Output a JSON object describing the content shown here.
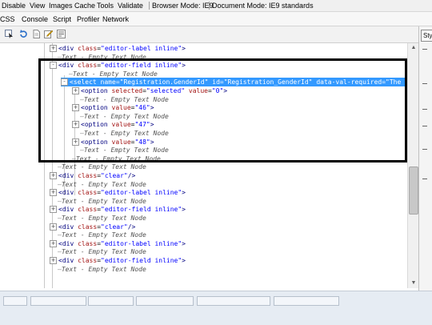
{
  "menu": [
    {
      "label": "Disable"
    },
    {
      "label": "View"
    },
    {
      "label": "Images"
    },
    {
      "label": "Cache"
    },
    {
      "label": "Tools"
    },
    {
      "label": "Validate"
    },
    {
      "label": "Browser Mode: IE9"
    },
    {
      "label": "Document Mode: IE9 standards"
    }
  ],
  "tabs": [
    {
      "label": "CSS"
    },
    {
      "label": "Console"
    },
    {
      "label": "Script"
    },
    {
      "label": "Profiler"
    },
    {
      "label": "Network"
    }
  ],
  "right_panel": {
    "style_tab": "Sty"
  },
  "tree": [
    {
      "kind": "elem",
      "expander": "+",
      "html_tag": "<div",
      "attrs": [
        {
          "n": "class",
          "v": "\"editor-label inline\""
        }
      ],
      "close": ">"
    },
    {
      "kind": "text",
      "text": "Text - Empty Text Node"
    },
    {
      "kind": "elem",
      "expander": "-",
      "html_tag": "<div",
      "attrs": [
        {
          "n": "class",
          "v": "\"editor-field inline\""
        }
      ],
      "close": ">"
    },
    {
      "kind": "text",
      "text": "Text - Empty Text Node"
    },
    {
      "kind": "sel",
      "expander": "-",
      "html_tag": "<select",
      "attrs": [
        {
          "n": "name",
          "v": "\"Registration.GenderId\""
        },
        {
          "n": "id",
          "v": "\"Registration_GenderId\""
        },
        {
          "n": "data-val-required",
          "v": "\"The Ge"
        }
      ],
      "close": ""
    },
    {
      "kind": "elem",
      "expander": "+",
      "html_tag": "<option",
      "attrs": [
        {
          "n": "selected",
          "v": "\"selected\""
        },
        {
          "n": "value",
          "v": "\"0\""
        }
      ],
      "close": ">"
    },
    {
      "kind": "text",
      "text": "Text - Empty Text Node"
    },
    {
      "kind": "elem",
      "expander": "+",
      "html_tag": "<option",
      "attrs": [
        {
          "n": "value",
          "v": "\"46\""
        }
      ],
      "close": ">"
    },
    {
      "kind": "text",
      "text": "Text - Empty Text Node"
    },
    {
      "kind": "elem",
      "expander": "+",
      "html_tag": "<option",
      "attrs": [
        {
          "n": "value",
          "v": "\"47\""
        }
      ],
      "close": ">"
    },
    {
      "kind": "text",
      "text": "Text - Empty Text Node"
    },
    {
      "kind": "elem",
      "expander": "+",
      "html_tag": "<option",
      "attrs": [
        {
          "n": "value",
          "v": "\"48\""
        }
      ],
      "close": ">"
    },
    {
      "kind": "text",
      "text": "Text - Empty Text Node"
    },
    {
      "kind": "text",
      "text": "Text - Empty Text Node"
    },
    {
      "kind": "text",
      "text": "Text - Empty Text Node"
    },
    {
      "kind": "elem",
      "expander": "+",
      "html_tag": "<div",
      "attrs": [
        {
          "n": "class",
          "v": "\"clear\""
        }
      ],
      "close": "/>"
    },
    {
      "kind": "text",
      "text": "Text - Empty Text Node"
    },
    {
      "kind": "elem",
      "expander": "+",
      "html_tag": "<div",
      "attrs": [
        {
          "n": "class",
          "v": "\"editor-label inline\""
        }
      ],
      "close": ">"
    },
    {
      "kind": "text",
      "text": "Text - Empty Text Node"
    },
    {
      "kind": "elem",
      "expander": "+",
      "html_tag": "<div",
      "attrs": [
        {
          "n": "class",
          "v": "\"editor-field inline\""
        }
      ],
      "close": ">"
    },
    {
      "kind": "text",
      "text": "Text - Empty Text Node"
    },
    {
      "kind": "elem",
      "expander": "+",
      "html_tag": "<div",
      "attrs": [
        {
          "n": "class",
          "v": "\"clear\""
        }
      ],
      "close": "/>"
    },
    {
      "kind": "text",
      "text": "Text - Empty Text Node"
    },
    {
      "kind": "elem",
      "expander": "+",
      "html_tag": "<div",
      "attrs": [
        {
          "n": "class",
          "v": "\"editor-label inline\""
        }
      ],
      "close": ">"
    },
    {
      "kind": "text",
      "text": "Text - Empty Text Node"
    },
    {
      "kind": "elem",
      "expander": "+",
      "html_tag": "<div",
      "attrs": [
        {
          "n": "class",
          "v": "\"editor-field inline\""
        }
      ],
      "close": ">"
    },
    {
      "kind": "text",
      "text": "Text - Empty Text Node"
    }
  ],
  "colors": {
    "selection": "#3399ff",
    "tag": "#000080",
    "attr_name": "#a31515",
    "attr_value": "#0000ff"
  }
}
